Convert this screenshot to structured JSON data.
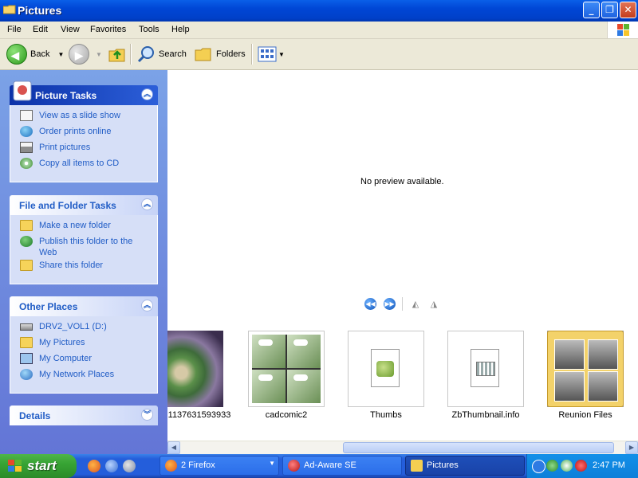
{
  "window": {
    "title": "Pictures",
    "controls": [
      "minimize",
      "restore",
      "close"
    ]
  },
  "menu": [
    "File",
    "Edit",
    "View",
    "Favorites",
    "Tools",
    "Help"
  ],
  "toolbar": {
    "back_label": "Back",
    "search_label": "Search",
    "folders_label": "Folders"
  },
  "taskpane": {
    "picture_tasks": {
      "title": "Picture Tasks",
      "items": [
        "View as a slide show",
        "Order prints online",
        "Print pictures",
        "Copy all items to CD"
      ]
    },
    "file_folder_tasks": {
      "title": "File and Folder Tasks",
      "items": [
        "Make a new folder",
        "Publish this folder to the Web",
        "Share this folder"
      ]
    },
    "other_places": {
      "title": "Other Places",
      "items": [
        "DRV2_VOL1 (D:)",
        "My Pictures",
        "My Computer",
        "My Network Places"
      ]
    },
    "details": {
      "title": "Details"
    }
  },
  "preview": {
    "message": "No preview available."
  },
  "files": [
    {
      "name": "1137631593933",
      "kind": "image"
    },
    {
      "name": "cadcomic2",
      "kind": "image"
    },
    {
      "name": "Thumbs",
      "kind": "file"
    },
    {
      "name": "ZbThumbnail.info",
      "kind": "file"
    },
    {
      "name": "Reunion Files",
      "kind": "folder"
    }
  ],
  "taskbar": {
    "start_label": "start",
    "buttons": [
      {
        "label": "2 Firefox",
        "icon": "firefox-icon"
      },
      {
        "label": "Ad-Aware SE",
        "icon": "ad-aware-icon"
      },
      {
        "label": "Pictures",
        "icon": "folder-icon",
        "active": true
      }
    ],
    "clock": "2:47 PM"
  },
  "colors": {
    "titlebar": "#0046d5",
    "taskpane": "#6375d6",
    "link": "#215dc6",
    "start": "#37a434"
  }
}
